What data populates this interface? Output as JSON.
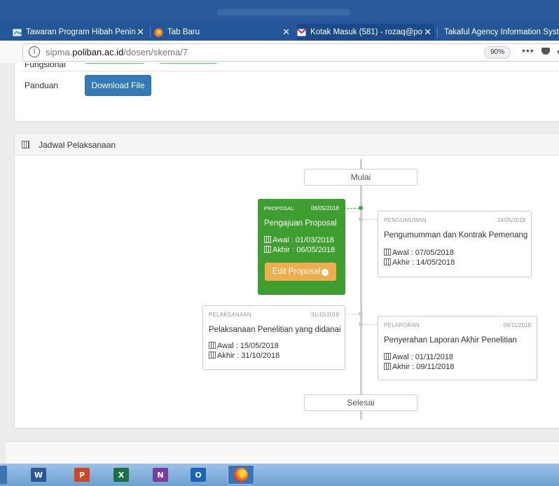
{
  "browser": {
    "tabs": [
      {
        "label": "Tawaran Program Hibah Penin",
        "icon": "doc-icon",
        "close": "✕"
      },
      {
        "label": "Tab Baru",
        "icon": "firefox-icon",
        "close": "✕"
      },
      {
        "label": "Kotak Masuk (581) - rozaq@po",
        "icon": "gmail-icon",
        "close": "✕"
      },
      {
        "label": "Takaful Agency Information Syste",
        "icon": "",
        "close": ""
      }
    ],
    "url_prefix": "sipma.",
    "url_domain": "poliban.ac.id",
    "url_path": "/dosen/skema/7",
    "zoom": "90%",
    "page_actions": "•••"
  },
  "panel_top": {
    "fungsional_label": "Fungsional",
    "panduan_label": "Panduan",
    "download_button": "Download File"
  },
  "jadwal": {
    "title": "Jadwal Pelaksanaan",
    "start_node": "Mulai",
    "end_node": "Selesai",
    "cards": [
      {
        "category": "PROPOSAL",
        "date": "06/05/2018",
        "title": "Pengajuan Proposal",
        "awal": "Awal : 01/03/2018",
        "akhir": "Akhir : 06/05/2018",
        "button": "Edit Proposal",
        "active": true
      },
      {
        "category": "PENGUMUMAN",
        "date": "14/05/2018",
        "title": "Pengumumman dan Kontrak Pemenang",
        "awal": "Awal : 07/05/2018",
        "akhir": "Akhir : 14/05/2018"
      },
      {
        "category": "PELAKSANAAN",
        "date": "31/10/2018",
        "title": "Pelaksanaan Penelitian yang didanai",
        "awal": "Awal : 15/05/2018",
        "akhir": "Akhir : 31/10/2018"
      },
      {
        "category": "PELAPORAN",
        "date": "09/11/2018",
        "title": "Penyerahan Laporan Akhir Penelitian",
        "awal": "Awal : 01/11/2018",
        "akhir": "Akhir : 09/11/2018"
      }
    ]
  },
  "taskbar": {
    "apps": [
      {
        "name": "word",
        "letter": "W",
        "color": "#2b5797"
      },
      {
        "name": "powerpoint",
        "letter": "P",
        "color": "#d04525"
      },
      {
        "name": "excel",
        "letter": "X",
        "color": "#1e7145"
      },
      {
        "name": "onenote",
        "letter": "N",
        "color": "#7a3b9a"
      },
      {
        "name": "outlook",
        "letter": "O",
        "color": "#1a63b5"
      }
    ]
  },
  "colors": {
    "accent_green": "#3e9e2f",
    "button_blue": "#337ab7",
    "button_orange": "#f0ad4e",
    "tabbar": "#24569a"
  }
}
